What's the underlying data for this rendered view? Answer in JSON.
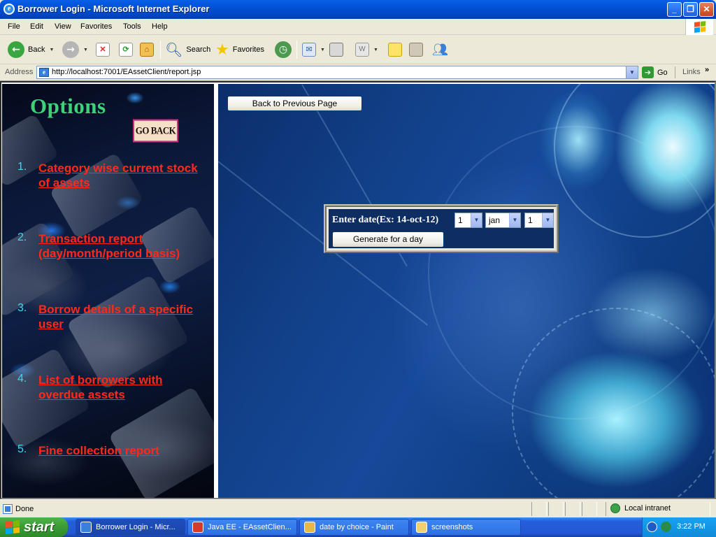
{
  "window": {
    "title": "Borrower Login - Microsoft Internet Explorer"
  },
  "menu": [
    "File",
    "Edit",
    "View",
    "Favorites",
    "Tools",
    "Help"
  ],
  "toolbar": {
    "back": "Back",
    "search": "Search",
    "favorites": "Favorites"
  },
  "address": {
    "label": "Address",
    "url": "http://localhost:7001/EAssetClient/report.jsp",
    "go": "Go",
    "links": "Links",
    "more": "»"
  },
  "left_frame": {
    "title": "Options",
    "go_back": "GO BACK",
    "options": [
      {
        "num": "1.",
        "label": "Category wise current stock of assets"
      },
      {
        "num": "2.",
        "label": "Transaction report (day/month/period basis)"
      },
      {
        "num": "3.",
        "label": "Borrow details of a specific user"
      },
      {
        "num": "4.",
        "label": "List of borrowers with overdue assets"
      },
      {
        "num": "5.",
        "label": "Fine collection report"
      }
    ]
  },
  "right_frame": {
    "back_button": "Back to Previous Page",
    "date_label": "Enter date(Ex: 14-oct-12)",
    "day_value": "1",
    "month_value": "jan",
    "year_value": "1",
    "generate_button": "Generate for a day"
  },
  "status": {
    "text": "Done",
    "zone": "Local intranet"
  },
  "taskbar": {
    "start": "start",
    "tasks": [
      "Borrower Login - Micr...",
      "Java EE - EAssetClien...",
      "date by choice - Paint",
      "screenshots"
    ],
    "clock": "3:22 PM"
  }
}
